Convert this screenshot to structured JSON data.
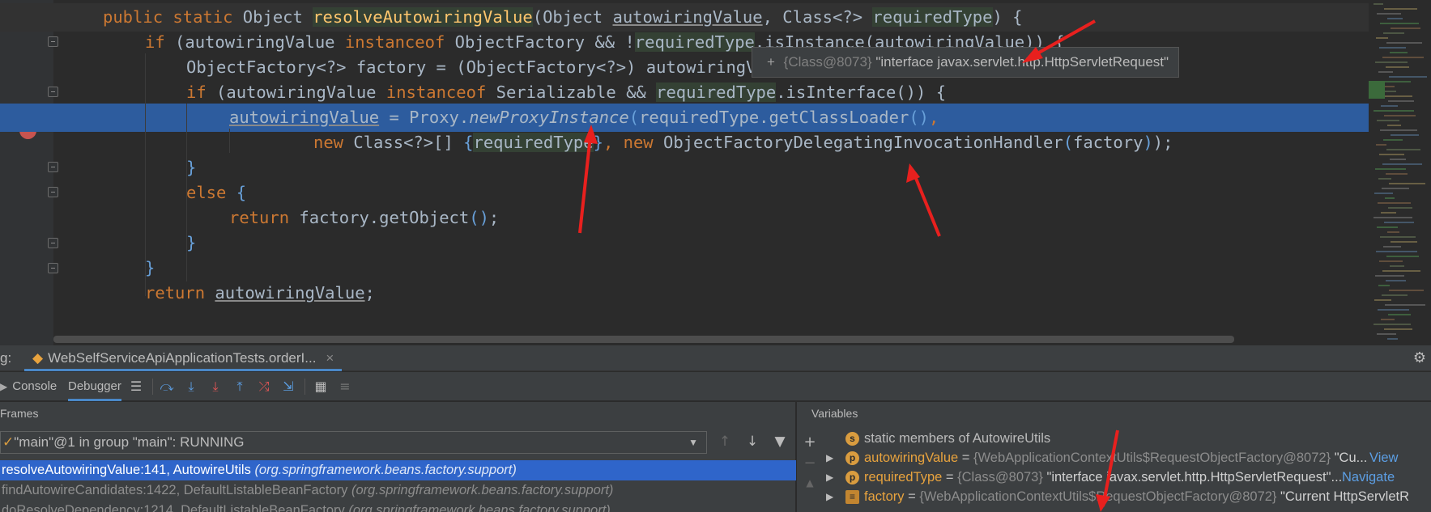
{
  "editor": {
    "lines": [
      {
        "tokens": [
          [
            "kw",
            "public static "
          ],
          [
            "t",
            "Object "
          ],
          [
            "fnhl",
            "resolveAutowiringValue"
          ],
          [
            "t",
            "(Object "
          ],
          [
            "ul",
            "autowiringValue"
          ],
          [
            "t",
            ", Class<?> "
          ],
          [
            "hlvar",
            "requiredType"
          ],
          [
            "t",
            ") {"
          ]
        ]
      },
      {
        "tokens": [
          [
            "kw",
            "if "
          ],
          [
            "t",
            "("
          ],
          [
            "t",
            "autowiringValue "
          ],
          [
            "kw",
            "instanceof "
          ],
          [
            "t",
            "ObjectFactory && !"
          ],
          [
            "hlvar",
            "requiredType"
          ],
          [
            "t",
            ".isInstance(autowiringValue)) {"
          ]
        ]
      },
      {
        "tokens": [
          [
            "t",
            "ObjectFactory<?> factory = (ObjectFactory<?>) autowiringValue;"
          ]
        ]
      },
      {
        "tokens": [
          [
            "kw",
            "if "
          ],
          [
            "t",
            "(autowiringValue "
          ],
          [
            "kw",
            "instanceof "
          ],
          [
            "t",
            "Serializable && "
          ],
          [
            "hlvar",
            "requiredType"
          ],
          [
            "t",
            ".isInterface()) {"
          ]
        ]
      },
      {
        "tokens": [
          [
            "ul",
            "autowiringValue"
          ],
          [
            "t",
            " = Proxy."
          ],
          [
            "it",
            "newProxyInstance"
          ],
          [
            "br",
            "("
          ],
          [
            "t",
            "requiredType.getClassLoader"
          ],
          [
            "br",
            "()"
          ],
          [
            "kw",
            ","
          ]
        ]
      },
      {
        "tokens": [
          [
            "kw",
            "new "
          ],
          [
            "t",
            "Class<?>[] "
          ],
          [
            "br",
            "{"
          ],
          [
            "hlvar",
            "requiredType"
          ],
          [
            "br",
            "}"
          ],
          [
            "kw",
            ", new "
          ],
          [
            "t",
            "ObjectFactoryDelegatingInvocationHandler"
          ],
          [
            "br",
            "("
          ],
          [
            "t",
            "factory"
          ],
          [
            "br",
            ")"
          ],
          [
            "t",
            ");"
          ]
        ]
      },
      {
        "tokens": [
          [
            "br",
            "}"
          ]
        ]
      },
      {
        "tokens": [
          [
            "kw",
            "else "
          ],
          [
            "br",
            "{"
          ]
        ]
      },
      {
        "tokens": [
          [
            "kw",
            "return "
          ],
          [
            "t",
            "factory.getObject"
          ],
          [
            "br",
            "()"
          ],
          [
            "t",
            ";"
          ]
        ]
      },
      {
        "tokens": [
          [
            "br",
            "}"
          ]
        ]
      },
      {
        "tokens": [
          [
            "br",
            "}"
          ]
        ]
      },
      {
        "tokens": [
          [
            "kw",
            "return "
          ],
          [
            "ul",
            "autowiringValue"
          ],
          [
            "t",
            ";"
          ]
        ]
      }
    ],
    "tooltip": {
      "plus": "+",
      "ref": "{Class@8073}",
      "value": "\"interface javax.servlet.http.HttpServletRequest\""
    }
  },
  "debug": {
    "window_label": "g:",
    "session_tab": "WebSelfServiceApiApplicationTests.orderI...",
    "session_close": "×",
    "tabs": {
      "console": "Console",
      "debugger": "Debugger"
    },
    "frames_title": "Frames",
    "variables_title": "Variables",
    "thread": "\"main\"@1 in group \"main\": RUNNING",
    "frames": [
      {
        "method": "resolveAutowiringValue:141, AutowireUtils",
        "pkg": "(org.springframework.beans.factory.support)"
      },
      {
        "method": "findAutowireCandidates:1422, DefaultListableBeanFactory",
        "pkg": "(org.springframework.beans.factory.support)"
      },
      {
        "method": "doResolveDependency:1214, DefaultListableBeanFactory",
        "pkg": "(org.springframework.beans.factory.support)"
      }
    ],
    "variables": [
      {
        "badge": "s",
        "name": "static",
        "rest": " members of AutowireUtils",
        "ref": "",
        "value": "",
        "link": ""
      },
      {
        "badge": "p",
        "name": "autowiringValue",
        "rest": " = ",
        "ref": "{WebApplicationContextUtils$RequestObjectFactory@8072}",
        "value": " \"Cu...",
        "link": "View"
      },
      {
        "badge": "p",
        "name": "requiredType",
        "rest": " = ",
        "ref": "{Class@8073}",
        "value": " \"interface javax.servlet.http.HttpServletRequest\"...",
        "link": "Navigate"
      },
      {
        "badge": "f",
        "name": "factory",
        "rest": " = ",
        "ref": "{WebApplicationContextUtils$RequestObjectFactory@8072}",
        "value": " \"Current HttpServletR",
        "link": ""
      }
    ]
  },
  "colors": {
    "accent": "#2f65ca",
    "keyword": "#cc7832",
    "method": "#ffc66d",
    "annotation": "#e8201e"
  }
}
